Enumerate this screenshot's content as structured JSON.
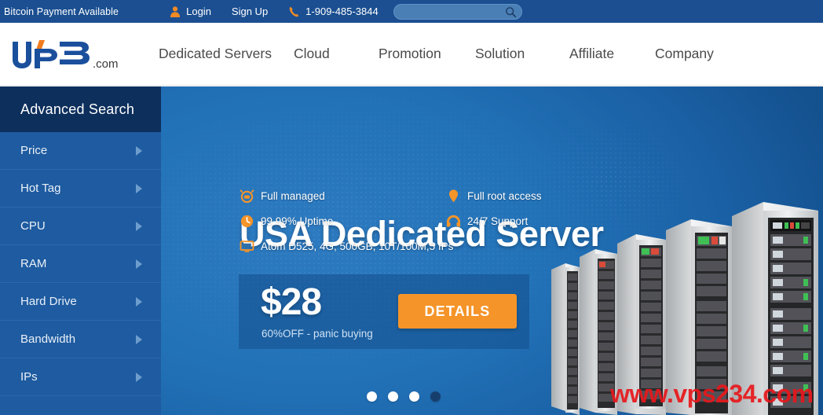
{
  "topbar": {
    "promo_text": "Bitcoin Payment Available",
    "login_label": "Login",
    "login_icon": "user-icon",
    "signup_label": "Sign Up",
    "phone_icon": "phone-icon",
    "phone_number": "1-909-485-3844",
    "search_icon": "search-icon",
    "search_value": "",
    "search_placeholder": "",
    "bg_color": "#1b4f91"
  },
  "header": {
    "logo_text": "VPB",
    "logo_suffix": ".com",
    "logo_color": "#1a4f9c",
    "logo_accent_color": "#f07c1e",
    "nav": [
      {
        "label": "Dedicated Servers"
      },
      {
        "label": "Cloud"
      },
      {
        "label": "Promotion"
      },
      {
        "label": "Solution"
      },
      {
        "label": "Affiliate"
      },
      {
        "label": "Company"
      }
    ]
  },
  "sidebar": {
    "title": "Advanced Search",
    "header_bg": "#0d2f5c",
    "body_bg": "#1e5ba0",
    "items": [
      {
        "label": "Price"
      },
      {
        "label": "Hot Tag"
      },
      {
        "label": "CPU"
      },
      {
        "label": "RAM"
      },
      {
        "label": "Hard Drive"
      },
      {
        "label": "Bandwidth"
      },
      {
        "label": "IPs"
      }
    ]
  },
  "hero": {
    "title": "USA Dedicated Server",
    "features": [
      {
        "icon": "alarm-clock-icon",
        "label": "Full managed"
      },
      {
        "icon": "shield-icon",
        "label": "Full root access"
      },
      {
        "icon": "clock-icon",
        "label": "99.99% Uptime"
      },
      {
        "icon": "headset-icon",
        "label": "24/7 Support"
      },
      {
        "icon": "monitor-icon",
        "label": "Atom D525, 4G, 500GB, 10T/100M,5 IPs"
      }
    ],
    "price": "$28",
    "price_note": "60%OFF - panic buying",
    "details_label": "DETAILS",
    "details_color": "#f59429",
    "carousel": {
      "count": 4,
      "active_index": 3
    },
    "watermark": "www.vps234.com",
    "watermark_color": "#e8171b"
  }
}
